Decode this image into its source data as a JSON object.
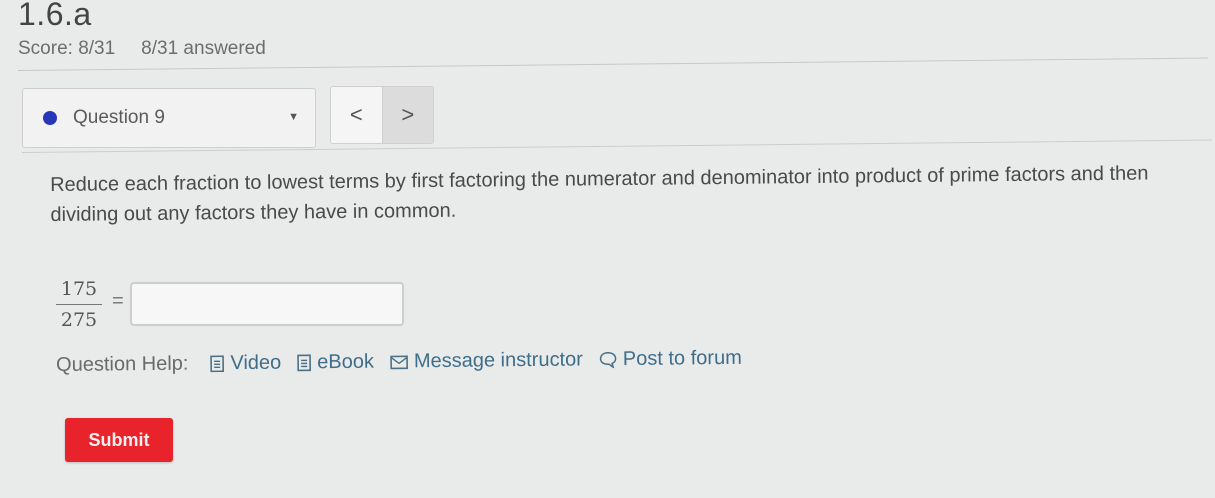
{
  "assignment": {
    "title": "1.6.a",
    "score": "Score: 8/31",
    "answered": "8/31 answered"
  },
  "question_nav": {
    "selected": "Question 9",
    "status_color": "#2737b8",
    "prev_icon": "chevron-left-icon",
    "next_icon": "chevron-right-icon",
    "prev_glyph": "<",
    "next_glyph": ">"
  },
  "question": {
    "prompt": "Reduce each fraction to lowest terms by first factoring the numerator and denominator into product of prime factors and then dividing out any factors they have in common.",
    "fraction": {
      "numerator": "175",
      "denominator": "275"
    },
    "equals": "=",
    "answer_value": ""
  },
  "help": {
    "label": "Question Help:",
    "links": [
      {
        "label": "Video",
        "icon": "document-icon"
      },
      {
        "label": "eBook",
        "icon": "document-icon"
      },
      {
        "label": "Message instructor",
        "icon": "envelope-icon"
      },
      {
        "label": "Post to forum",
        "icon": "speech-bubble-icon"
      }
    ]
  },
  "submit": {
    "label": "Submit",
    "color": "#e8232b"
  }
}
